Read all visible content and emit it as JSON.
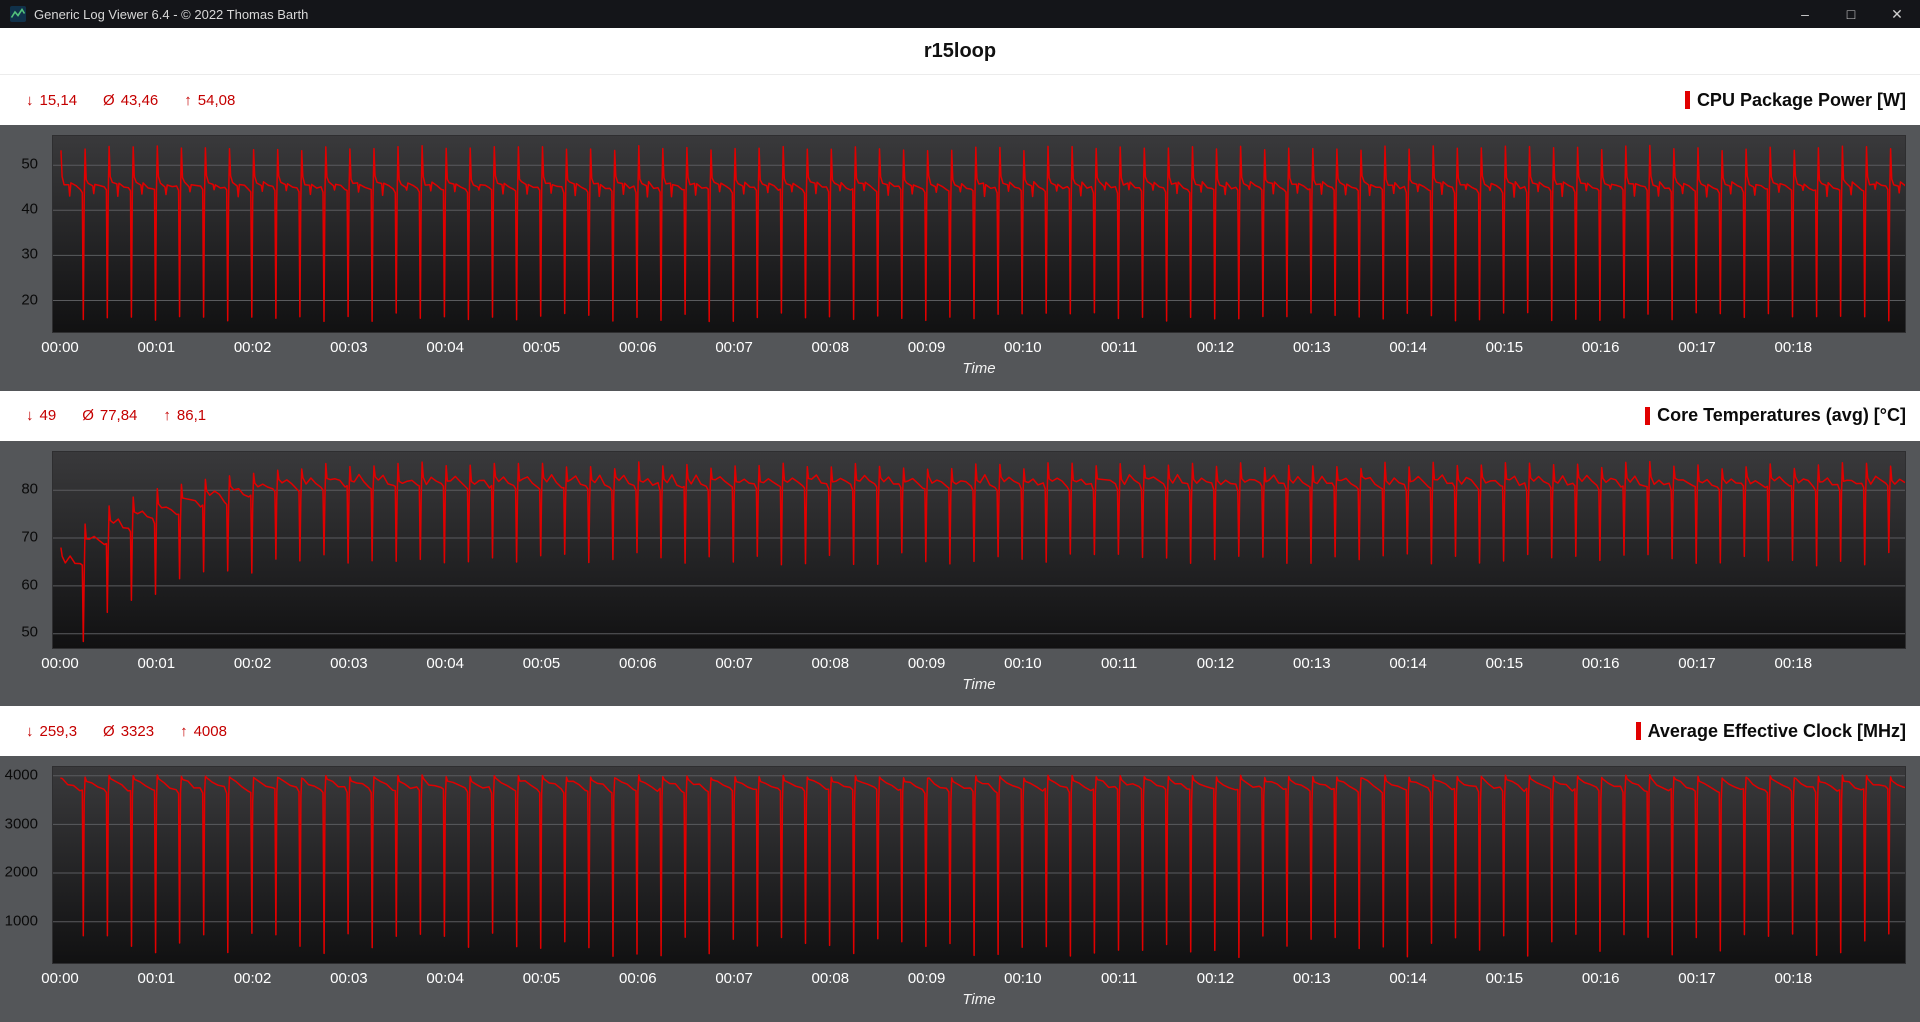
{
  "window": {
    "title": "Generic Log Viewer 6.4 - © 2022 Thomas Barth",
    "controls": {
      "minimize": "–",
      "maximize": "□",
      "close": "✕"
    }
  },
  "header": {
    "title": "r15loop"
  },
  "stats_symbols": {
    "min": "↓",
    "avg": "Ø",
    "max": "↑"
  },
  "axis": {
    "time_label": "Time"
  },
  "colors": {
    "series_red": "#e10000",
    "stats_red": "#c40000",
    "panel_gray": "#545659",
    "plot_top": "#39393b",
    "plot_bottom": "#111112",
    "grid": "#5a5b5e",
    "titlebar": "#141519",
    "y_label": "#0a0a0a",
    "x_label": "#ffffff"
  },
  "sections": [
    {
      "title": "CPU Package Power [W]",
      "stats": {
        "min": "15,14",
        "avg": "43,46",
        "max": "54,08"
      }
    },
    {
      "title": "Core Temperatures (avg) [°C]",
      "stats": {
        "min": "49",
        "avg": "77,84",
        "max": "86,1"
      }
    },
    {
      "title": "Average Effective Clock [MHz]",
      "stats": {
        "min": "259,3",
        "avg": "3323",
        "max": "4008"
      }
    }
  ],
  "chart_data": [
    {
      "type": "line",
      "title": "CPU Package Power [W]",
      "unit": "W",
      "xlabel": "Time",
      "x_ticks": [
        "00:00",
        "00:01",
        "00:02",
        "00:03",
        "00:04",
        "00:05",
        "00:06",
        "00:07",
        "00:08",
        "00:09",
        "00:10",
        "00:11",
        "00:12",
        "00:13",
        "00:14",
        "00:15",
        "00:16",
        "00:17",
        "00:18"
      ],
      "x_tick_interval_s": 60,
      "duration_s": 1144,
      "y_ticks": [
        20,
        30,
        40,
        50
      ],
      "y_range": [
        13,
        56.5
      ],
      "grid": true,
      "legend_position": "top-right",
      "summary": {
        "min": 15.14,
        "avg": 43.46,
        "max": 54.08
      },
      "line_color": "#e10000",
      "waveform": {
        "description": "Cinebench R15 loop: spike to ~54 W, plateau ~45-46 W, sharp dip to ~15-17 W between runs, repeating every ~15 s",
        "period_s": 15,
        "keyframes": [
          [
            0.0,
            53.8,
            0.6
          ],
          [
            0.045,
            47.2,
            0.5
          ],
          [
            0.13,
            46.0,
            0.4
          ],
          [
            0.32,
            45.6,
            0.5
          ],
          [
            0.36,
            43.8,
            0.9
          ],
          [
            0.41,
            46.0,
            0.4
          ],
          [
            0.62,
            45.2,
            0.4
          ],
          [
            0.8,
            44.9,
            0.5
          ],
          [
            0.885,
            44.3,
            0.5
          ],
          [
            0.925,
            16.3,
            1.0
          ],
          [
            0.962,
            43.0,
            1.0
          ]
        ],
        "warmup_offsets": []
      }
    },
    {
      "type": "line",
      "title": "Core Temperatures (avg) [°C]",
      "unit": "°C",
      "xlabel": "Time",
      "x_ticks": [
        "00:00",
        "00:01",
        "00:02",
        "00:03",
        "00:04",
        "00:05",
        "00:06",
        "00:07",
        "00:08",
        "00:09",
        "00:10",
        "00:11",
        "00:12",
        "00:13",
        "00:14",
        "00:15",
        "00:16",
        "00:17",
        "00:18"
      ],
      "x_tick_interval_s": 60,
      "duration_s": 1144,
      "y_ticks": [
        50,
        60,
        70,
        80
      ],
      "y_range": [
        47,
        88
      ],
      "grid": true,
      "legend_position": "top-right",
      "summary": {
        "min": 49,
        "avg": 77.84,
        "max": 86.1
      },
      "line_color": "#e10000",
      "waveform": {
        "description": "Per-run temperature cycles: peak ~85 °C, plateau ~81-83 °C, dip to ~65 °C; first ~2 minutes ramp up from ~49-67 °C while warming",
        "period_s": 15,
        "keyframes": [
          [
            0.0,
            85.2,
            0.8
          ],
          [
            0.05,
            82.3,
            0.6
          ],
          [
            0.18,
            81.8,
            0.6
          ],
          [
            0.38,
            82.6,
            0.7
          ],
          [
            0.58,
            81.6,
            0.6
          ],
          [
            0.8,
            81.0,
            0.6
          ],
          [
            0.885,
            80.4,
            0.6
          ],
          [
            0.925,
            65.6,
            1.4
          ],
          [
            0.962,
            79.0,
            1.0
          ]
        ],
        "warmup_offsets": [
          -16.5,
          -12,
          -9,
          -7,
          -5.5,
          -4,
          -3,
          -2,
          -1.2,
          -0.6
        ]
      }
    },
    {
      "type": "line",
      "title": "Average Effective Clock [MHz]",
      "unit": "MHz",
      "xlabel": "Time",
      "x_ticks": [
        "00:00",
        "00:01",
        "00:02",
        "00:03",
        "00:04",
        "00:05",
        "00:06",
        "00:07",
        "00:08",
        "00:09",
        "00:10",
        "00:11",
        "00:12",
        "00:13",
        "00:14",
        "00:15",
        "00:16",
        "00:17",
        "00:18"
      ],
      "x_tick_interval_s": 60,
      "duration_s": 1144,
      "y_ticks": [
        1000,
        2000,
        3000,
        4000
      ],
      "y_range": [
        150,
        4180
      ],
      "grid": true,
      "legend_position": "top-right",
      "summary": {
        "min": 259.3,
        "avg": 3323,
        "max": 4008
      },
      "line_color": "#e10000",
      "waveform": {
        "description": "Clock holds ~3700-4000 MHz during each run, drops to ~260-780 MHz between runs, every ~15 s",
        "period_s": 15,
        "keyframes": [
          [
            0.0,
            3985,
            35
          ],
          [
            0.06,
            3915,
            40
          ],
          [
            0.28,
            3855,
            45
          ],
          [
            0.52,
            3790,
            50
          ],
          [
            0.78,
            3730,
            55
          ],
          [
            0.885,
            3690,
            55
          ],
          [
            0.928,
            520,
            260
          ],
          [
            0.965,
            3550,
            120
          ]
        ],
        "warmup_offsets": []
      }
    }
  ]
}
